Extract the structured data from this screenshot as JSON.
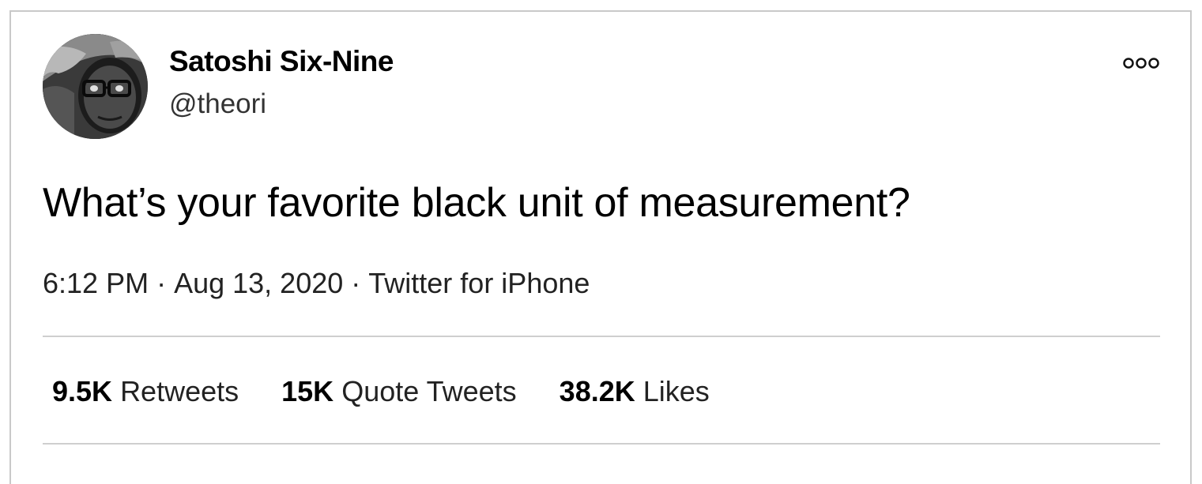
{
  "tweet": {
    "author": {
      "display_name": "Satoshi Six-Nine",
      "handle": "@theori"
    },
    "text": "What’s your favorite black unit of measurement?",
    "meta": {
      "time": "6:12 PM",
      "date": "Aug 13, 2020",
      "source": "Twitter for iPhone",
      "separator": "·"
    },
    "stats": [
      {
        "count": "9.5K",
        "label": "Retweets"
      },
      {
        "count": "15K",
        "label": "Quote Tweets"
      },
      {
        "count": "38.2K",
        "label": "Likes"
      }
    ],
    "icons": {
      "more": "more-options-icon",
      "avatar": "avatar-photo"
    }
  }
}
